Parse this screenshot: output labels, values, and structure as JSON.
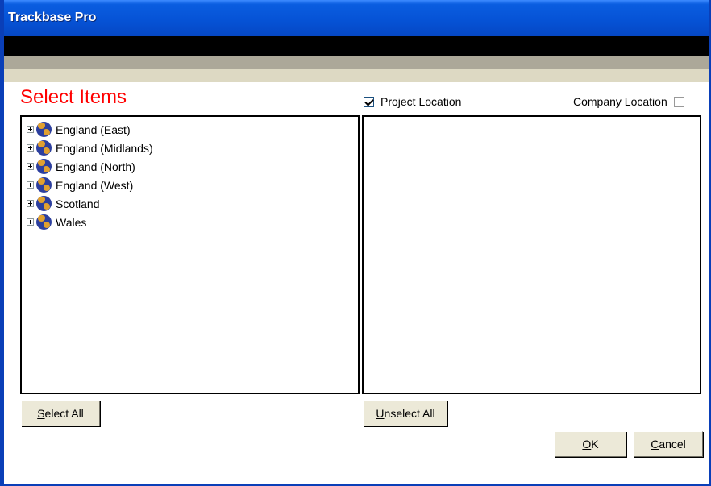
{
  "window": {
    "title": "Trackbase Pro"
  },
  "heading": "Select Items",
  "options": {
    "project_location": {
      "label": "Project Location",
      "checked": true
    },
    "company_location": {
      "label": "Company Location",
      "checked": false
    }
  },
  "tree": {
    "items": [
      {
        "label": "England (East)",
        "icon": "globe-icon"
      },
      {
        "label": "England (Midlands)",
        "icon": "globe-icon"
      },
      {
        "label": "England (North)",
        "icon": "globe-icon"
      },
      {
        "label": "England (West)",
        "icon": "globe-icon"
      },
      {
        "label": "Scotland",
        "icon": "globe-icon"
      },
      {
        "label": "Wales",
        "icon": "globe-icon"
      }
    ]
  },
  "selected_items": [],
  "buttons": {
    "select_all": {
      "accel": "S",
      "rest": "elect All"
    },
    "unselect_all": {
      "accel": "U",
      "rest": "nselect All"
    },
    "ok": {
      "accel": "O",
      "rest": "K"
    },
    "cancel": {
      "accel": "C",
      "rest": "ancel"
    }
  },
  "colors": {
    "heading": "#ff0000",
    "titlebar": "#0653d6"
  }
}
